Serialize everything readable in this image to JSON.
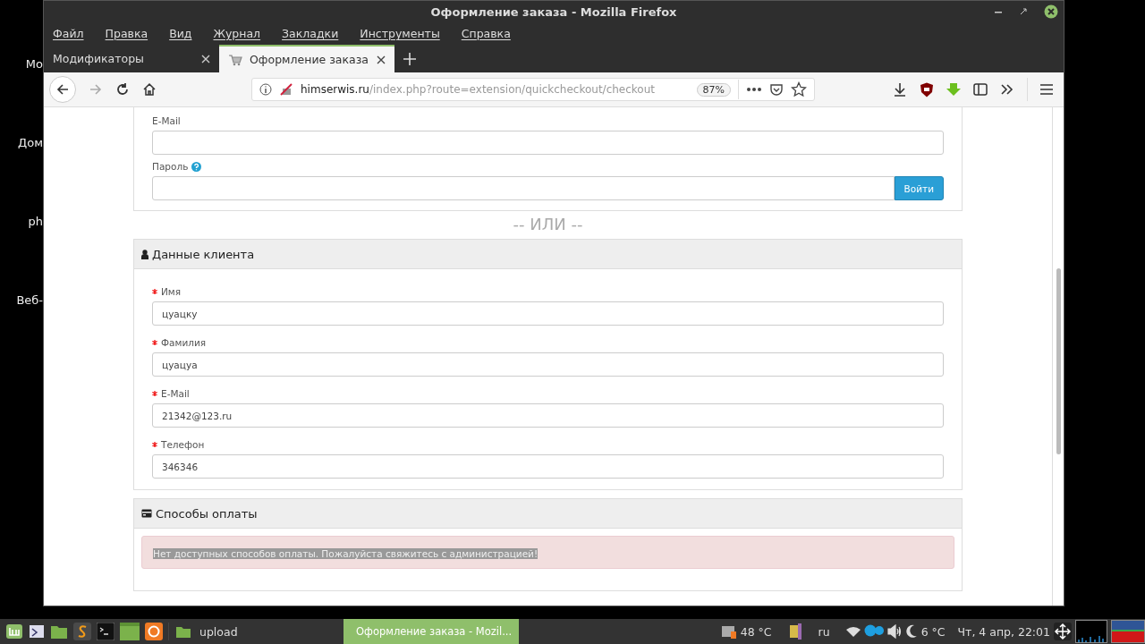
{
  "desktop_labels": [
    "Мо",
    "Дом",
    "ph",
    "Веб-"
  ],
  "window": {
    "title": "Оформление заказа - Mozilla Firefox"
  },
  "menu": [
    "Файл",
    "Правка",
    "Вид",
    "Журнал",
    "Закладки",
    "Инструменты",
    "Справка"
  ],
  "tabs": [
    {
      "label": "Модификаторы",
      "selected": false
    },
    {
      "label": "Оформление заказа",
      "selected": true
    }
  ],
  "address": {
    "host": "himserwis.ru",
    "path": "/index.php?route=extension/quickcheckout/checkout",
    "zoom": "87%"
  },
  "login": {
    "fields": [
      {
        "label": "E-Mail",
        "help": false
      },
      {
        "label": "Пароль",
        "help": true
      }
    ],
    "button": "Войти"
  },
  "or_divider": "-- ИЛИ --",
  "customer": {
    "title": "Данные клиента",
    "fields": [
      {
        "label": "Имя",
        "required": true,
        "value": "цуацку"
      },
      {
        "label": "Фамилия",
        "required": true,
        "value": "цуацуа"
      },
      {
        "label": "E-Mail",
        "required": true,
        "value": "21342@123.ru"
      },
      {
        "label": "Телефон",
        "required": true,
        "value": "346346"
      }
    ]
  },
  "payment": {
    "title": "Способы оплаты",
    "alert": "Нет доступных способов оплаты. Пожалуйста свяжитесь с администрацией!"
  },
  "taskbar": {
    "windows": [
      {
        "label": "upload",
        "selected": false
      },
      {
        "label": "Оформление заказа - Mozil...",
        "selected": true
      }
    ],
    "cpu_temp": "48 °C",
    "lang": "ru",
    "weather": "6 °C",
    "clock": "Чт,  4 апр, 22:01"
  }
}
